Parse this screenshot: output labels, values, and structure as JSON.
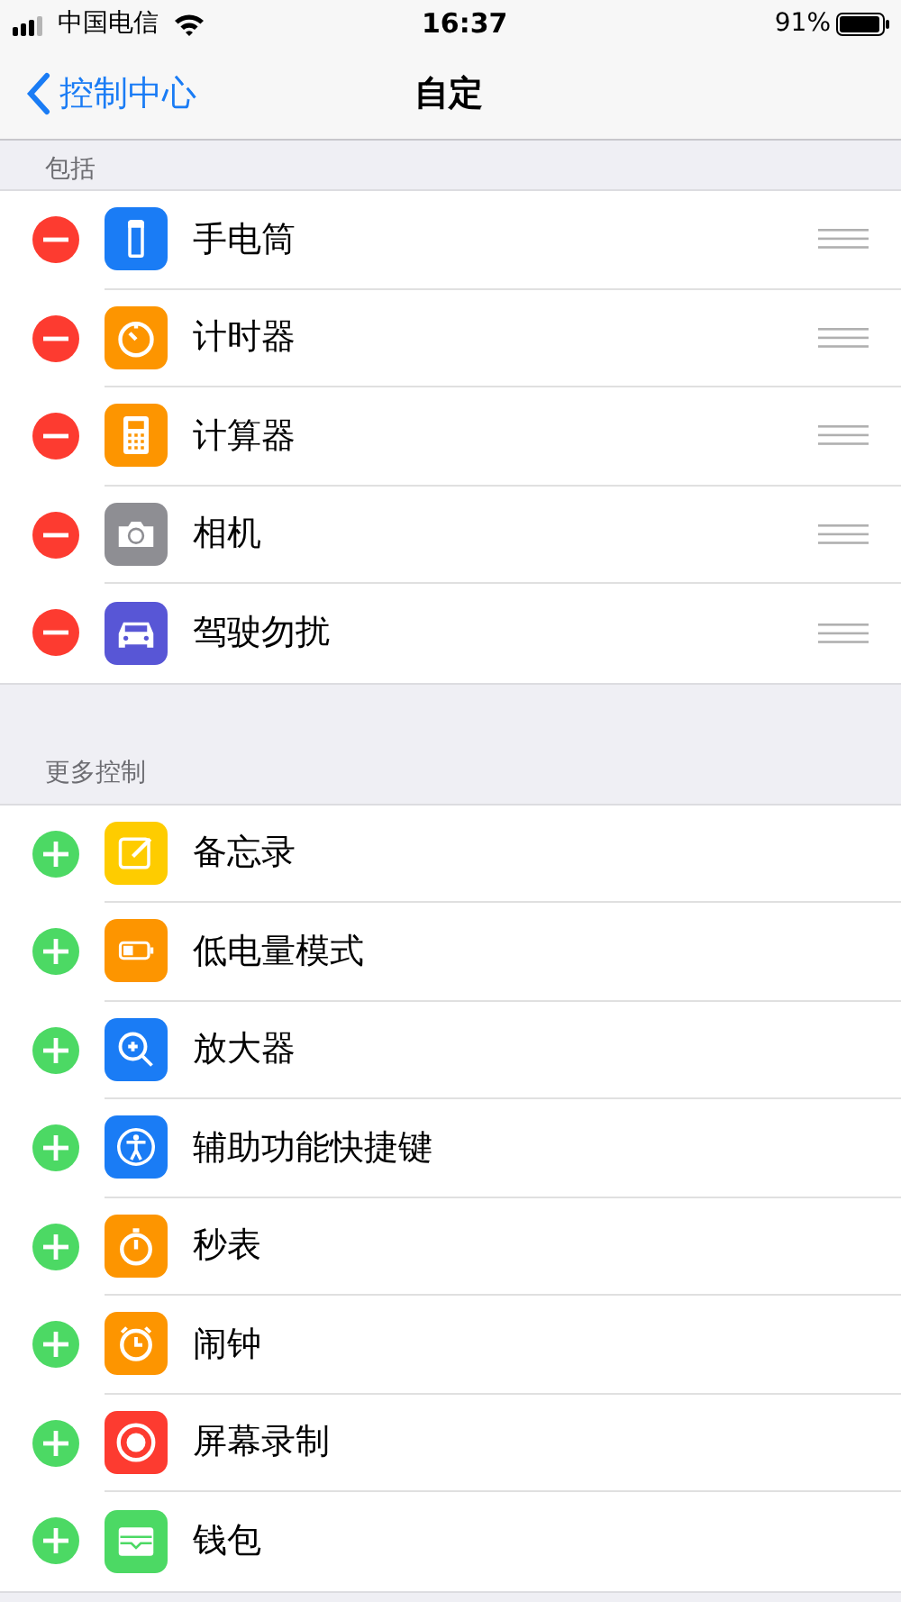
{
  "status_bar": {
    "carrier": "中国电信",
    "time": "16:37",
    "battery": "91%"
  },
  "nav": {
    "back": "控制中心",
    "title": "自定"
  },
  "sections": [
    {
      "header": "包括",
      "kind": "remove",
      "items": [
        {
          "label": "手电筒",
          "color": "#1a7cf5"
        },
        {
          "label": "计时器",
          "color": "#fd9500"
        },
        {
          "label": "计算器",
          "color": "#fd9500"
        },
        {
          "label": "相机",
          "color": "#8e8e93"
        },
        {
          "label": "驾驶勿扰",
          "color": "#5856d6"
        }
      ]
    },
    {
      "header": "更多控制",
      "kind": "add",
      "items": [
        {
          "label": "备忘录",
          "color": "#fecc00"
        },
        {
          "label": "低电量模式",
          "color": "#fd9500"
        },
        {
          "label": "放大器",
          "color": "#1a7cf5"
        },
        {
          "label": "辅助功能快捷键",
          "color": "#1a7cf5"
        },
        {
          "label": "秒表",
          "color": "#fd9500"
        },
        {
          "label": "闹钟",
          "color": "#fd9500"
        },
        {
          "label": "屏幕录制",
          "color": "#fd3b30"
        },
        {
          "label": "钱包",
          "color": "#4cd964"
        }
      ]
    }
  ]
}
